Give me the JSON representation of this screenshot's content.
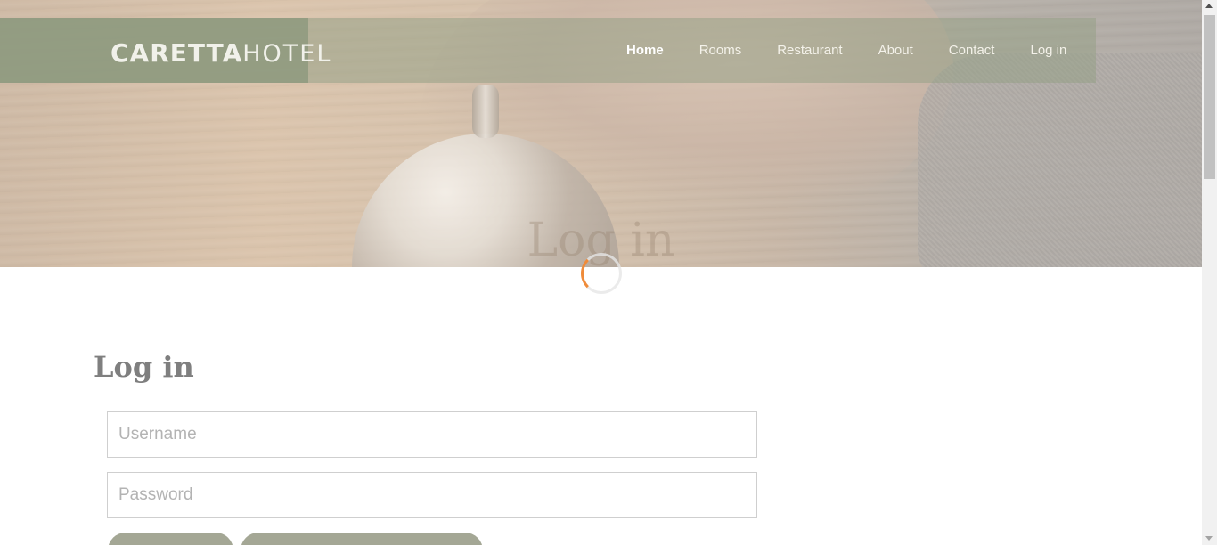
{
  "brand": {
    "logo_bold": "CARETTA",
    "logo_light": "HOTEL"
  },
  "nav": {
    "items": [
      {
        "label": "Home",
        "active": true
      },
      {
        "label": "Rooms"
      },
      {
        "label": "Restaurant"
      },
      {
        "label": "About"
      },
      {
        "label": "Contact"
      },
      {
        "label": "Log in"
      }
    ]
  },
  "hero": {
    "title": "Log in"
  },
  "login": {
    "heading": "Log in",
    "username_placeholder": "Username",
    "password_placeholder": "Password"
  },
  "colors": {
    "header_bg": "#96a087",
    "button_bg": "#a4a795",
    "spinner_accent": "#ef8b3a"
  }
}
